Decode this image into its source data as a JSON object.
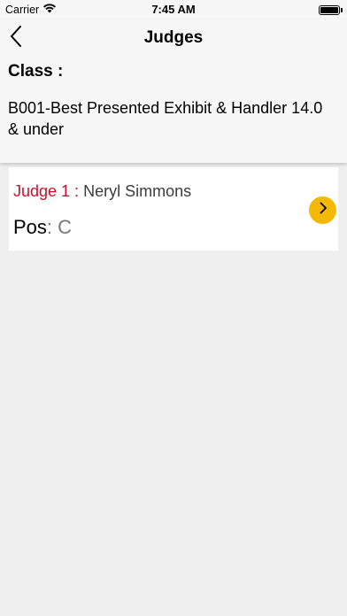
{
  "status_bar": {
    "carrier": "Carrier",
    "time": "7:45 AM",
    "wifi_icon": "wifi-icon",
    "battery_icon": "battery-icon"
  },
  "nav": {
    "title": "Judges",
    "back_icon": "chevron-left-icon"
  },
  "class_info": {
    "label": "Class :",
    "name": "B001-Best Presented Exhibit & Handler 14.0 & under"
  },
  "judges": [
    {
      "label": "Judge 1 :",
      "name": "Neryl Simmons",
      "pos_label": "Pos",
      "pos_separator": ":",
      "pos_value": "C",
      "action_icon": "chevron-right-icon"
    }
  ],
  "colors": {
    "judge_label": "#c8102e",
    "accent_button": "#f5b800",
    "background": "#efefef",
    "header_background": "#f7f7f7"
  }
}
